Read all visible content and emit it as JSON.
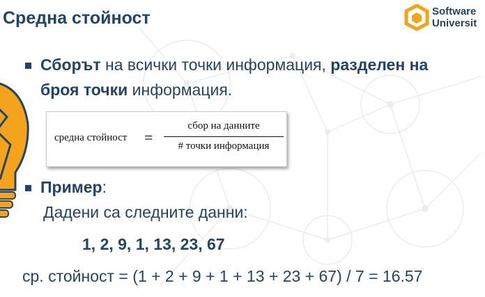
{
  "slide": {
    "title": "Средна стойност",
    "logo": {
      "line1": "Software",
      "line2": "Universit"
    },
    "bullet1": {
      "part1": "Сборът",
      "part2": " на всички точки информация, ",
      "part3": "разделен на",
      "part4": "броя точки",
      "part5": " информация."
    },
    "formula": {
      "lhs": "средна стойност",
      "equals": "=",
      "numerator": "сбор на данните",
      "denominator": "# точки информация"
    },
    "bullet2": {
      "label": "Пример",
      "colon": ":"
    },
    "given": "Дадени са следните данни:",
    "values": "1, 2, 9, 1, 13, 23, 67",
    "result": "ср. стойност = (1 + 2 + 9 + 1 + 13 + 23 + 67) / 7 = 16.57"
  },
  "colors": {
    "text": "#234465",
    "accent": "#f4a41c",
    "background_lines": "#e6e6e6"
  },
  "icons": [
    "software-university-logo-icon",
    "lightbulb-icon",
    "bullet-square-icon"
  ]
}
